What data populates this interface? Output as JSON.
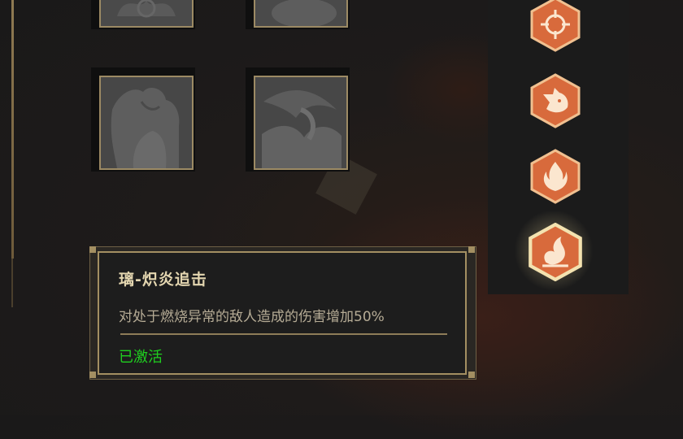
{
  "skill_tooltip": {
    "title": "璃-炽炎追击",
    "description": "对处于燃烧异常的敌人造成的伤害增加50%",
    "status": "已激活"
  },
  "colors": {
    "gold": "#a38f62",
    "status_green": "#1fcf1f",
    "hex_orange": "#d86a3c"
  },
  "skill_icons": [
    {
      "name": "crosshair-icon"
    },
    {
      "name": "beast-head-icon"
    },
    {
      "name": "fire-crest-icon"
    },
    {
      "name": "flame-swirl-icon",
      "active": true
    }
  ]
}
